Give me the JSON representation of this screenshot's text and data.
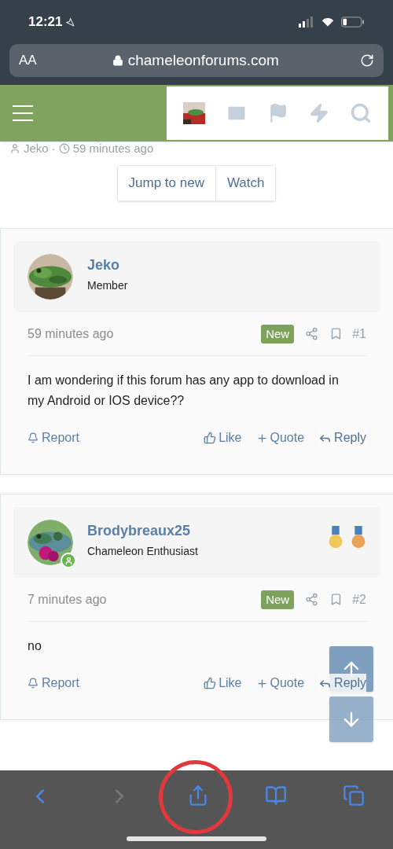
{
  "status_bar": {
    "time": "12:21"
  },
  "address_bar": {
    "text_size": "AA",
    "url": "chameleonforums.com"
  },
  "thread_meta": {
    "author": "Jeko",
    "separator": "·",
    "time": "59 minutes ago"
  },
  "thread_buttons": [
    "Jump to new",
    "Watch"
  ],
  "posts": [
    {
      "author": "Jeko",
      "role": "Member",
      "online": false,
      "time": "59 minutes ago",
      "badge": "New",
      "number": "#1",
      "body": "I am wondering if this forum has any app to download in my Android or IOS device??",
      "actions": {
        "report": "Report",
        "like": "Like",
        "quote": "Quote",
        "reply": "Reply"
      }
    },
    {
      "author": "Brodybreaux25",
      "role": "Chameleon Enthusiast",
      "online": true,
      "medals": [
        {
          "color": "#f2c75a"
        },
        {
          "color": "#e8a35a"
        }
      ],
      "time": "7 minutes ago",
      "badge": "New",
      "number": "#2",
      "body": "no",
      "actions": {
        "report": "Report",
        "like": "Like",
        "quote": "Quote",
        "reply": "Reply"
      }
    }
  ]
}
